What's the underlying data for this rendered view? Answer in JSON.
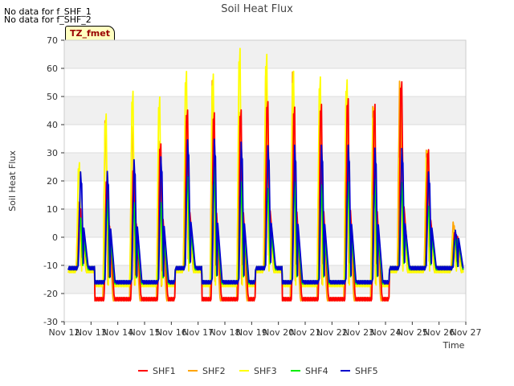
{
  "notes": [
    "No data for f_SHF_1",
    "No data for f_SHF_2"
  ],
  "site_tag": "TZ_fmet",
  "colors": {
    "SHF1": "#ff0000",
    "SHF2": "#ffa500",
    "SHF3": "#ffff00",
    "SHF4": "#00ee00",
    "SHF5": "#0000cc"
  },
  "chart_data": {
    "type": "line",
    "title": "Soil Heat Flux",
    "xlabel": "Time",
    "ylabel": "Soil Heat Flux",
    "ylim": [
      -30,
      70
    ],
    "xlim": [
      0,
      15
    ],
    "yticks": [
      -30,
      -20,
      -10,
      0,
      10,
      20,
      30,
      40,
      50,
      60,
      70
    ],
    "xticks": [
      "Nov 12",
      "Nov 13",
      "Nov 14",
      "Nov 15",
      "Nov 16",
      "Nov 17",
      "Nov 18",
      "Nov 19",
      "Nov 20",
      "Nov 21",
      "Nov 22",
      "Nov 23",
      "Nov 24",
      "Nov 25",
      "Nov 26",
      "Nov 27"
    ],
    "grid": true,
    "legend": "bottom",
    "series": [
      {
        "name": "SHF1",
        "night": -11,
        "dark": -22,
        "peaks": [
          10,
          21,
          25,
          33,
          45,
          44,
          45,
          48,
          46,
          47,
          49,
          47,
          55,
          31,
          2
        ]
      },
      {
        "name": "SHF2",
        "night": -12,
        "dark": -22,
        "peaks": [
          12,
          40,
          38,
          33,
          40,
          54,
          43,
          56,
          57,
          43,
          46,
          45,
          54,
          30,
          5
        ]
      },
      {
        "name": "SHF3",
        "night": -12,
        "dark": -17,
        "peaks": [
          26,
          43,
          51,
          49,
          58,
          57,
          66,
          64,
          58,
          56,
          55,
          45,
          30,
          30,
          2
        ]
      },
      {
        "name": "SHF4",
        "night": -11,
        "dark": -16,
        "peaks": [
          6,
          12,
          11,
          11,
          20,
          23,
          18,
          16,
          18,
          17,
          18,
          19,
          18,
          10,
          0
        ]
      },
      {
        "name": "SHF5",
        "night": -11,
        "dark": -16,
        "peaks": [
          22,
          22,
          26,
          27,
          33,
          33,
          32,
          31,
          31,
          31,
          31,
          30,
          30,
          22,
          2
        ]
      }
    ]
  }
}
